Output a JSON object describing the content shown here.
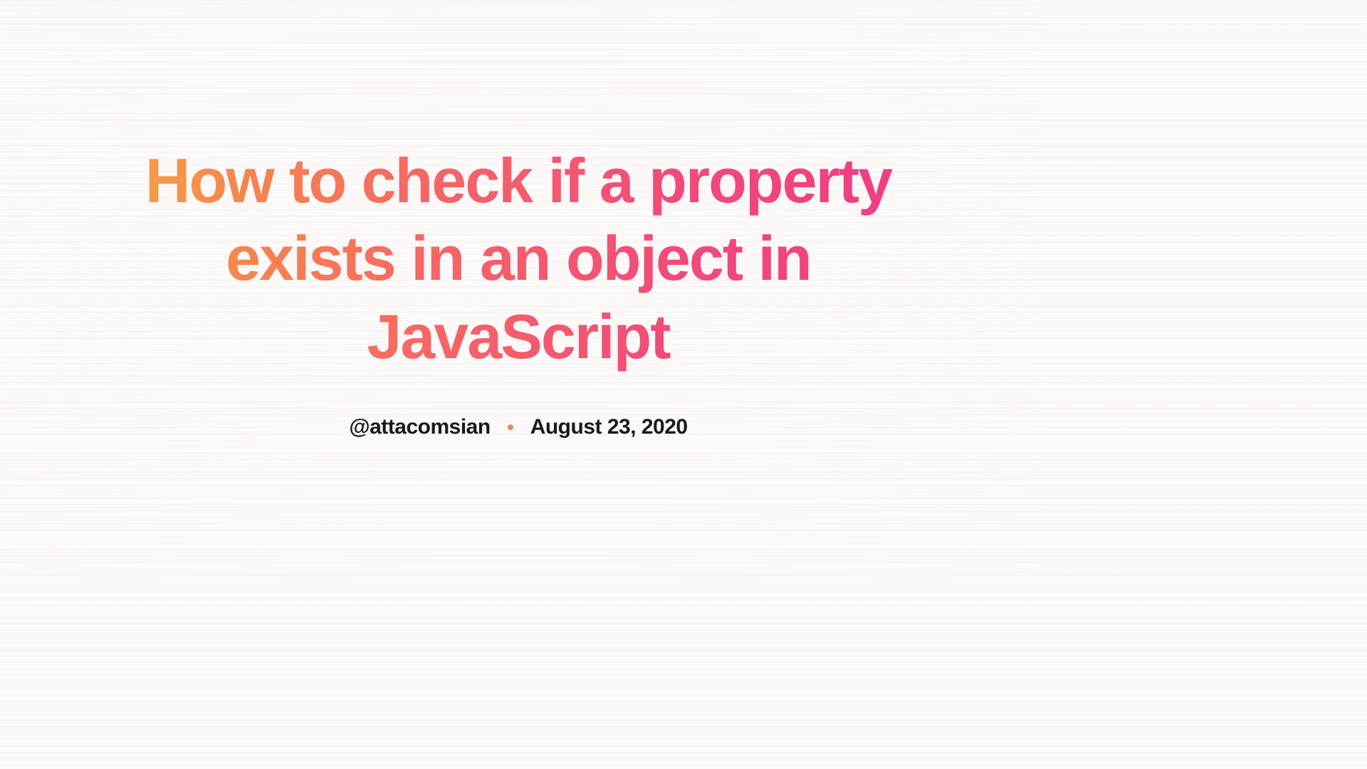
{
  "article": {
    "title": "How to check if a property exists in an object in JavaScript",
    "author_handle": "@attacomsian",
    "date": "August 23, 2020"
  }
}
